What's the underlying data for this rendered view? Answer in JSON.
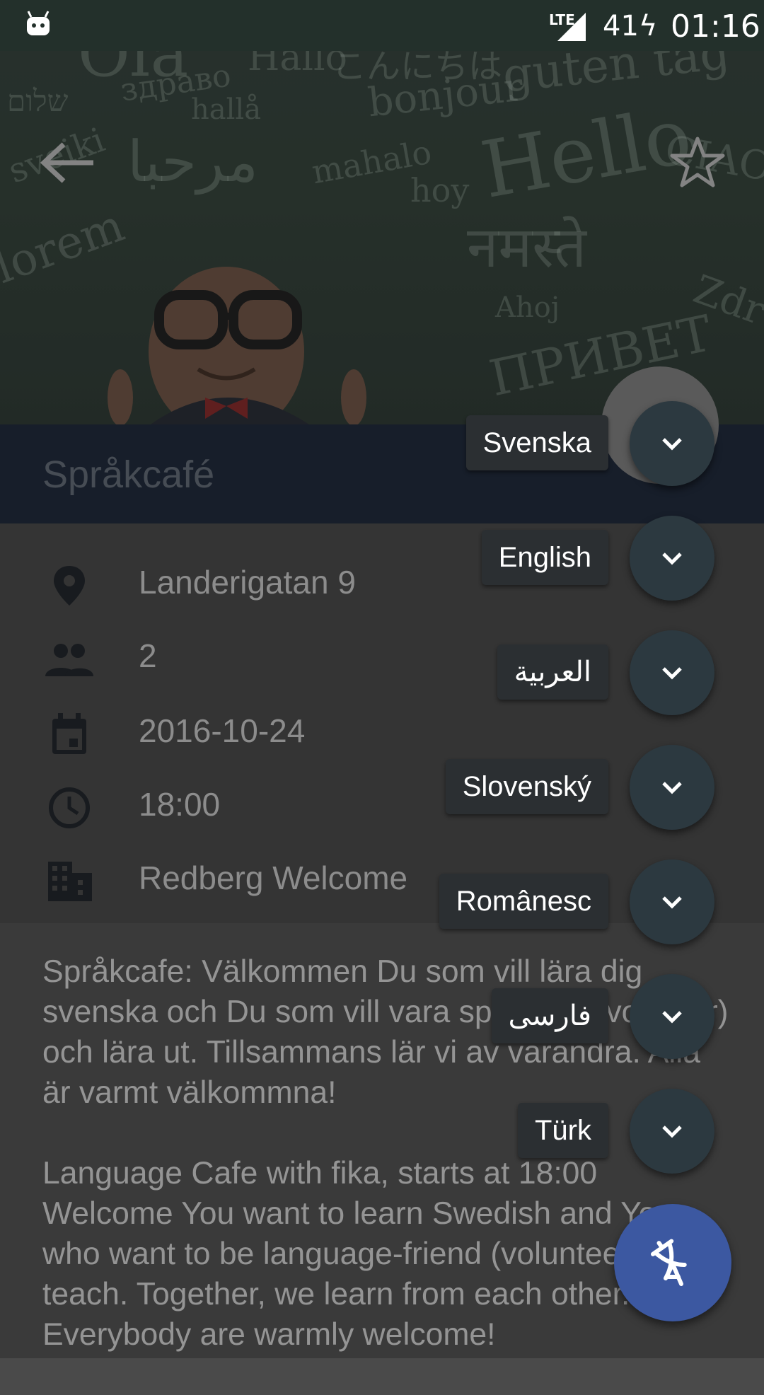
{
  "status_bar": {
    "network": "LTE",
    "battery": "41",
    "time": "01:16"
  },
  "header": {
    "background_words": [
      "Ola",
      "Hallo",
      "こんにちは",
      "guten tag",
      "שלום",
      "здраво",
      "hallå",
      "bonjour",
      "Hello",
      "CIAO",
      "sveiki",
      "مرحبا",
      "mahalo",
      "hoy",
      "lorem",
      "नमस्ते",
      "Ahoj",
      "ПРИВЕТ",
      "Zdr"
    ]
  },
  "event": {
    "title": "Språkcafé",
    "address": "Landerigatan 9",
    "attendees": "2",
    "date": "2016-10-24",
    "time": "18:00",
    "organizer": "Redberg Welcome"
  },
  "description": {
    "swedish": "Språkcafe: Välkommen Du som vill lära dig svenska och Du som vill vara språkvän (volontär) och lära ut. Tillsammans lär vi av varandra. Alla är varmt välkommna!",
    "english": "Language Cafe with fika, starts at 18:00 Welcome You want to learn Swedish and You who want to be language-friend (volunteer) and teach. Together, we learn from each other. Everybody are warmly welcome!"
  },
  "language_menu": {
    "items": [
      {
        "label": "Svenska"
      },
      {
        "label": "English"
      },
      {
        "label": "العربية"
      },
      {
        "label": "Slovenský"
      },
      {
        "label": "Românesc"
      },
      {
        "label": "فارسی"
      },
      {
        "label": "Türk"
      }
    ]
  },
  "colors": {
    "title_band": "#0e1a2f",
    "fab": "#3c58a1",
    "mini_fab": "#2c3940",
    "label_bg": "#2b2f32"
  },
  "icons": [
    "back-arrow-icon",
    "star-outline-icon",
    "location-pin-icon",
    "people-icon",
    "calendar-icon",
    "clock-icon",
    "building-icon",
    "chevron-down-icon",
    "translate-icon"
  ]
}
